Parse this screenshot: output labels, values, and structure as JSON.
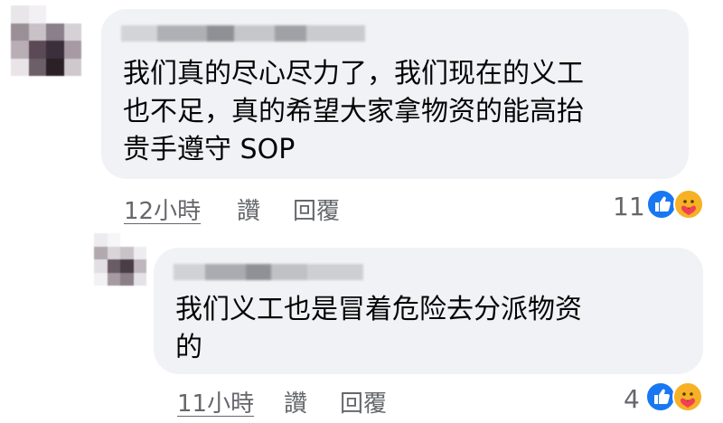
{
  "comments": [
    {
      "text_lines": [
        "我们真的尽心尽力了，我们现在的义工",
        "也不足，真的希望大家拿物资的能高抬",
        "贵手遵守 SOP"
      ],
      "time": "12小時",
      "like_label": "讚",
      "reply_label": "回覆",
      "reaction_count": "11",
      "reactions": [
        "like-icon",
        "care-icon"
      ]
    },
    {
      "text_lines": [
        "我们义工也是冒着危险去分派物资",
        "的"
      ],
      "time": "11小時",
      "like_label": "讚",
      "reply_label": "回覆",
      "reaction_count": "4",
      "reactions": [
        "like-icon",
        "care-icon"
      ]
    }
  ],
  "colors": {
    "bubble": "#f0f2f5",
    "meta_text": "#65676b",
    "like_blue": "#1877f2",
    "care_yellow": "#f7b125"
  }
}
